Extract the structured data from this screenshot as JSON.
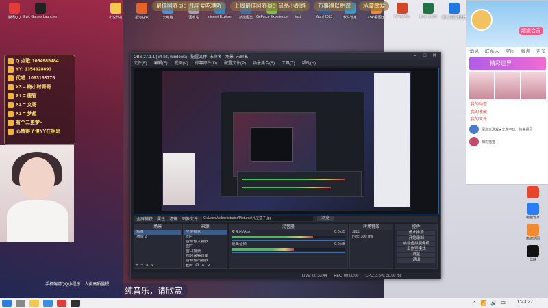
{
  "desktop_icons_left": [
    {
      "label": "腾讯QQ",
      "color": "#e23b3b"
    },
    {
      "label": "Epic Games Launcher",
      "color": "#222222"
    }
  ],
  "desktop_icons_top": [
    {
      "label": "小说代打",
      "color": "#f2c94c"
    },
    {
      "label": "星河狂欢",
      "color": "#e3632a"
    },
    {
      "label": "云电脑",
      "color": "#4a90e2"
    },
    {
      "label": "回收站",
      "color": "#9aa4b2"
    },
    {
      "label": "Internet Explorer",
      "color": "#2a8bd8"
    },
    {
      "label": "技能图鉴",
      "color": "#3a6fb0"
    },
    {
      "label": "GeForce Experience",
      "color": "#7ac143"
    },
    {
      "label": "inst",
      "color": "#5a5a5a"
    },
    {
      "label": "Word 2013",
      "color": "#2b579a"
    },
    {
      "label": "软件管家",
      "color": "#2e9bd6"
    },
    {
      "label": "2345看图王",
      "color": "#f28b30"
    },
    {
      "label": "PowerPoi..",
      "color": "#d24726"
    },
    {
      "label": "Excel 2013",
      "color": "#217346"
    },
    {
      "label": "腾讯视频播放器",
      "color": "#1f7ae0"
    },
    {
      "label": "向日葵",
      "color": "#e8452c"
    }
  ],
  "banner": [
    "最佳阿养员：凡尘爱吃糖吖",
    "上周最佳阿养员：鼠品小胡路",
    "万事得以相识",
    "承蒙厚爱"
  ],
  "chatlist": [
    "Q 点歌:1064985484",
    "YY: 1354328893",
    "代唱: 1093163775",
    "X3 = 梅小时哥哥",
    "X1 = 唐管",
    "X1 = 文哥",
    "X1 = 梦想",
    "有个二更梦~",
    "心情得了俊YY在相思"
  ],
  "obs": {
    "title": "OBS 27.1.1 (64-bit, windows) - 配置文件: 未命名 - 场景: 未命名",
    "menu": [
      "文件(F)",
      "编辑(E)",
      "视图(V)",
      "停靠部件(D)",
      "配置文件(P)",
      "场景集合(S)",
      "工具(T)",
      "帮助(H)"
    ],
    "source_label": "全屏捕获",
    "properties": "属性",
    "filters": "滤镜",
    "image_file_label": "图像文件",
    "path": "C:/Users/Administrator/Pictures/凡尘盒子.jpg",
    "browse": "浏览",
    "docks": {
      "scenes": {
        "title": "场景",
        "items": [
          "场景",
          "场景 2"
        ]
      },
      "sources": {
        "title": "来源",
        "items": [
          "全屏捕获",
          "图片",
          "音频输入捕获",
          "图片",
          "窗口捕获",
          "视频采集设备",
          "音频输出捕获",
          "图片"
        ]
      },
      "mixer": {
        "title": "混音器",
        "channels": [
          {
            "name": "麦克风/Aux",
            "db": "0.0 dB",
            "level": 0.72
          },
          {
            "name": "桌面音频",
            "db": "0.0 dB",
            "level": 0.55
          }
        ]
      },
      "transitions": {
        "title": "转场特效",
        "type": "淡出",
        "duration_label": "时长",
        "duration": "300 ms"
      },
      "controls": {
        "title": "控件",
        "buttons": [
          "停止推流",
          "开始录制",
          "启动虚拟摄像机",
          "工作室模式",
          "设置",
          "退出"
        ]
      }
    },
    "status": [
      "LIVE: 00:33:44",
      "REC: 00:00:00",
      "CPU: 3.5%, 30.00 fps"
    ]
  },
  "preview_caption": "纯音乐，请欣赏",
  "caption": "纯音乐，请欣赏",
  "subcaption": "手机端请QQ小程序：人类高质量视",
  "qq": {
    "vip_label": "超级会员",
    "tabs": [
      "消息",
      "联系人",
      "空间",
      "看点",
      "更多"
    ],
    "banner": "精彩世界",
    "items": [
      "我的动态",
      "我的收藏",
      "我的文件"
    ],
    "chats": [
      {
        "name": "深圳三游戏★无游不玩、快来组团",
        "color": "#4a7bd0"
      },
      {
        "name": "相思猫猫",
        "color": "#c44a6a"
      }
    ]
  },
  "right_apps": [
    {
      "label": "",
      "color": "#e8452c"
    },
    {
      "label": "电脑管家",
      "color": "#2d7df6"
    },
    {
      "label": "高德地图",
      "color": "#f28b30"
    },
    {
      "label": "剪映",
      "color": "#111111"
    }
  ],
  "taskbar": {
    "tray": "⌃ 📶 🔊 中",
    "clock": "1:23:27"
  }
}
